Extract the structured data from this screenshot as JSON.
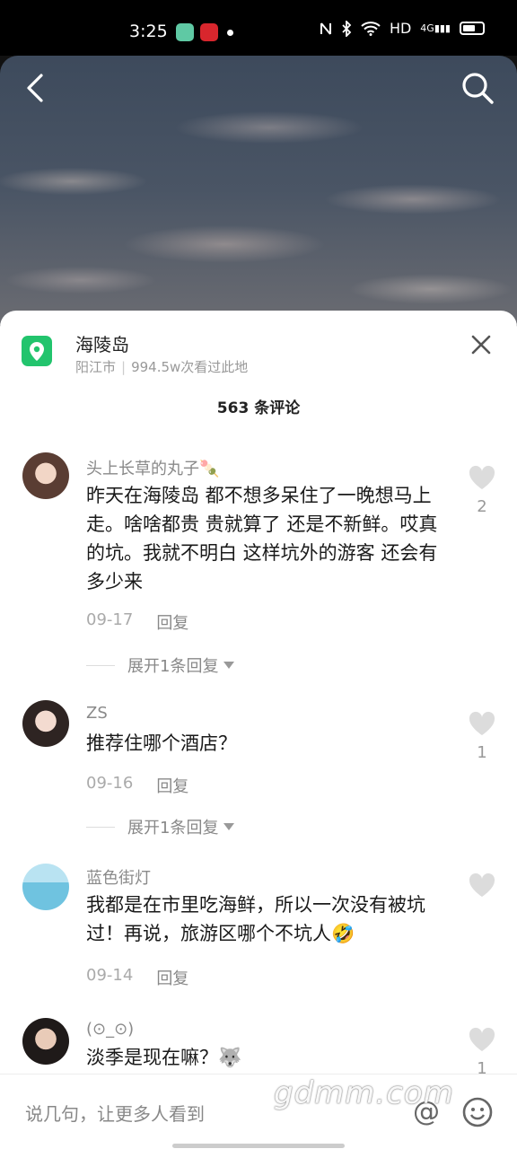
{
  "status": {
    "time": "3:25",
    "network": "HD",
    "cell": "4G"
  },
  "location": {
    "name": "海陵岛",
    "city": "阳江市",
    "visitors": "994.5w次看过此地"
  },
  "comment_count": "563 条评论",
  "comments": [
    {
      "user": "头上长草的丸子🍡",
      "text": "昨天在海陵岛 都不想多呆住了一晚想马上走。啥啥都贵 贵就算了 还是不新鲜。哎真的坑。我就不明白 这样坑外的游客 还会有多少来",
      "date": "09-17",
      "reply": "回复",
      "likes": "2",
      "expand": "展开1条回复"
    },
    {
      "user": "ZS",
      "text": "推荐住哪个酒店？",
      "date": "09-16",
      "reply": "回复",
      "likes": "1",
      "expand": "展开1条回复"
    },
    {
      "user": "蓝色街灯",
      "text": "我都是在市里吃海鲜，所以一次没有被坑过！再说，旅游区哪个不坑人🤣",
      "date": "09-14",
      "reply": "回复",
      "likes": ""
    },
    {
      "user": "(⊙_⊙)",
      "text": "淡季是现在嘛？🐺",
      "likes": "1"
    }
  ],
  "input": {
    "placeholder": "说几句，让更多人看到",
    "at": "@"
  },
  "watermark": "gdmm.com",
  "colors": {
    "accent_green": "#22c46d",
    "heart": "#dcdcdc"
  }
}
